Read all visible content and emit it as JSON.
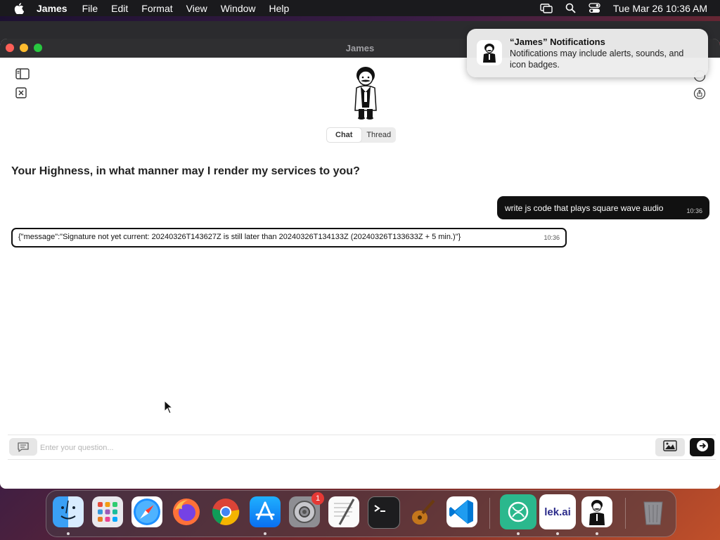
{
  "menubar": {
    "app_name": "James",
    "items": [
      "File",
      "Edit",
      "Format",
      "View",
      "Window",
      "Help"
    ],
    "clock": "Tue Mar 26  10:36 AM"
  },
  "window": {
    "title": "James",
    "tabs": [
      {
        "label": "Chat",
        "active": true
      },
      {
        "label": "Thread",
        "active": false
      }
    ],
    "greeting": "Your Highness, in what manner may I render my services to you?"
  },
  "messages": {
    "user": {
      "text": "write js code that plays square wave audio",
      "time": "10:36"
    },
    "bot": {
      "text": "{\"message\":\"Signature not yet current: 20240326T143627Z is still later than 20240326T134133Z (20240326T133633Z + 5 min.)\"}",
      "time": "10:36"
    }
  },
  "input": {
    "placeholder": "Enter your question..."
  },
  "notification": {
    "title": "“James” Notifications",
    "body": "Notifications may include alerts, sounds, and icon badges."
  },
  "dock": {
    "apps": [
      "finder-icon",
      "launchpad-icon",
      "safari-icon",
      "firefox-icon",
      "chrome-icon",
      "app-store-icon",
      "system-settings-icon",
      "textedit-icon",
      "terminal-icon",
      "garageband-icon",
      "vscode-icon",
      "chatgpt-icon",
      "lek-ai-icon",
      "james-icon",
      "trash-icon"
    ],
    "settings_badge": "1",
    "lek_label": "lek.ai"
  },
  "colors": {
    "accent": "#111111",
    "close": "#fe5f57",
    "minimize": "#febc2e",
    "maximize": "#28c840",
    "badge": "#e53935"
  }
}
